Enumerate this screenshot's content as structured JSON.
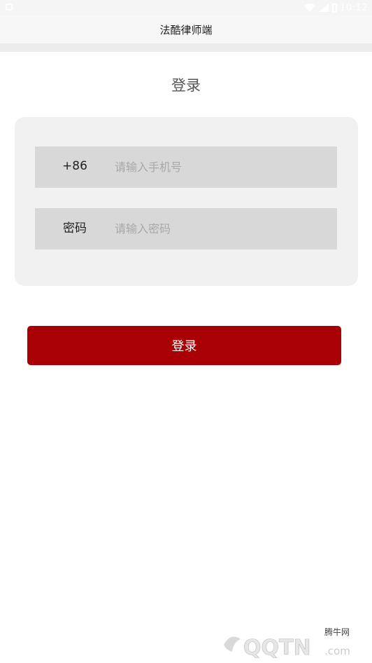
{
  "status_bar": {
    "time": "10:12"
  },
  "header": {
    "title": "法酷律师端"
  },
  "login": {
    "page_title": "登录",
    "phone": {
      "prefix": "+86",
      "placeholder": "请输入手机号",
      "value": ""
    },
    "password": {
      "label": "密码",
      "placeholder": "请输入密码",
      "value": ""
    },
    "submit_label": "登录"
  },
  "watermark": {
    "site_name": "腾牛网",
    "logo_text": "QQTN.com"
  },
  "colors": {
    "accent": "#a80005",
    "card_bg": "#f1f1f1",
    "field_bg": "#d8d8d8",
    "placeholder": "#a8a8a8"
  },
  "icons": {
    "status_left": "notification-icon",
    "wifi": "wifi-icon",
    "signal": "signal-icon",
    "battery": "battery-icon"
  }
}
